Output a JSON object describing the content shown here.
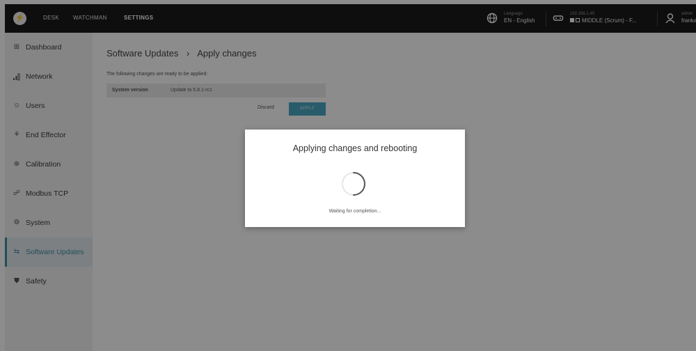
{
  "topbar": {
    "tabs": [
      "DESK",
      "WATCHMAN",
      "SETTINGS"
    ],
    "active_tab": "SETTINGS",
    "language_label": "Language",
    "language_value": "EN - English",
    "robot_ip": "192.168.1.45",
    "robot_name": "MIDDLE (Scrum) - F...",
    "user_role": "admin",
    "user_name": "franka"
  },
  "sidebar": {
    "items": [
      {
        "label": "Dashboard",
        "icon": "dashboard-icon",
        "glyph": "⊞"
      },
      {
        "label": "Network",
        "icon": "network-icon",
        "glyph": "📶"
      },
      {
        "label": "Users",
        "icon": "users-icon",
        "glyph": "☺"
      },
      {
        "label": "End Effector",
        "icon": "end-effector-icon",
        "glyph": "⚘"
      },
      {
        "label": "Calibration",
        "icon": "calibration-icon",
        "glyph": "⊕"
      },
      {
        "label": "Modbus TCP",
        "icon": "modbus-icon",
        "glyph": "☍"
      },
      {
        "label": "System",
        "icon": "system-icon",
        "glyph": "⚙"
      },
      {
        "label": "Software Updates",
        "icon": "software-updates-icon",
        "glyph": "⇆"
      },
      {
        "label": "Safety",
        "icon": "safety-icon",
        "glyph": "⛊"
      }
    ],
    "active": "Software Updates"
  },
  "main": {
    "breadcrumb": [
      "Software Updates",
      "›",
      "Apply changes"
    ],
    "intro": "The following changes are ready to be applied:",
    "changes": [
      {
        "name": "System version",
        "value": "Update to 5.8.1-rc1"
      }
    ],
    "discard_label": "Discard",
    "apply_label": "APPLY"
  },
  "modal": {
    "title": "Applying changes and rebooting",
    "status": "Waiting for completion..."
  },
  "colors": {
    "accent": "#3e8ea5",
    "apply_button": "#4aa8c3",
    "topbar": "#1b1b1b"
  }
}
